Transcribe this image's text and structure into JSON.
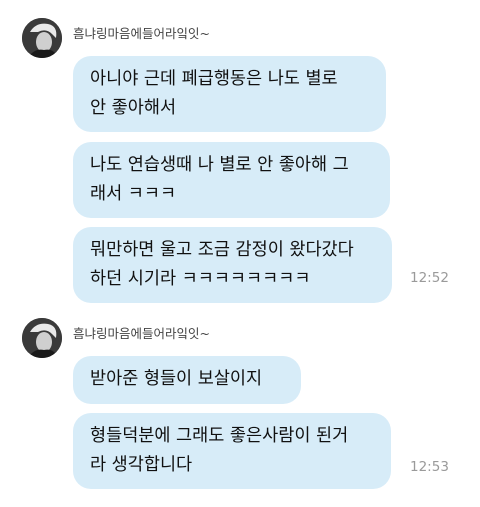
{
  "groups": [
    {
      "sender": "흠냐링마음에들어라잌잇~",
      "messages": [
        {
          "text": "아니야 근데 폐급행동은 나도 별로\n안 좋아해서"
        },
        {
          "text": "나도 연습생때 나 별로 안 좋아해 그\n래서 ㅋㅋㅋ"
        },
        {
          "text": "뭐만하면 울고 조금 감정이 왔다갔다\n하던 시기라 ㅋㅋㅋㅋㅋㅋㅋㅋ"
        }
      ],
      "time": "12:52"
    },
    {
      "sender": "흠냐링마음에들어라잌잇~",
      "messages": [
        {
          "text": "받아준 형들이 보살이지"
        },
        {
          "text": "형들덕분에 그래도 좋은사람이 된거\n라 생각합니다"
        }
      ],
      "time": "12:53"
    }
  ],
  "colors": {
    "bubble": "#d7ecf8",
    "background": "#ffffff",
    "timestamp": "#9a9a9a"
  },
  "icons": {
    "avatar": "profile-photo"
  }
}
